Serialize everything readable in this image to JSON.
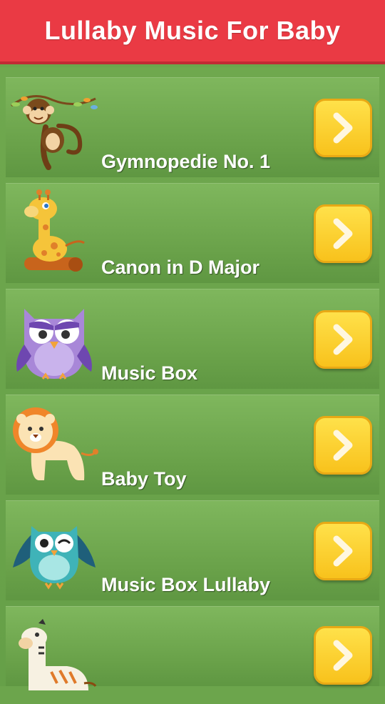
{
  "header": {
    "title": "Lullaby Music For Baby"
  },
  "songs": [
    {
      "title": "Gymnopedie No. 1",
      "animal_icon": "monkey-icon"
    },
    {
      "title": "Canon in D Major",
      "animal_icon": "giraffe-icon"
    },
    {
      "title": "Music Box",
      "animal_icon": "purple-owl-icon"
    },
    {
      "title": "Baby Toy",
      "animal_icon": "lion-icon"
    },
    {
      "title": "Music Box Lullaby",
      "animal_icon": "teal-owl-icon"
    },
    {
      "title": "",
      "animal_icon": "zebra-icon"
    }
  ],
  "colors": {
    "header": "#ea3a44",
    "background": "#6ca54c",
    "row": "#72ab52",
    "button": "#fbcb22",
    "label_text": "#ffffff"
  },
  "icons": {
    "play_button": "chevron-right-icon"
  }
}
